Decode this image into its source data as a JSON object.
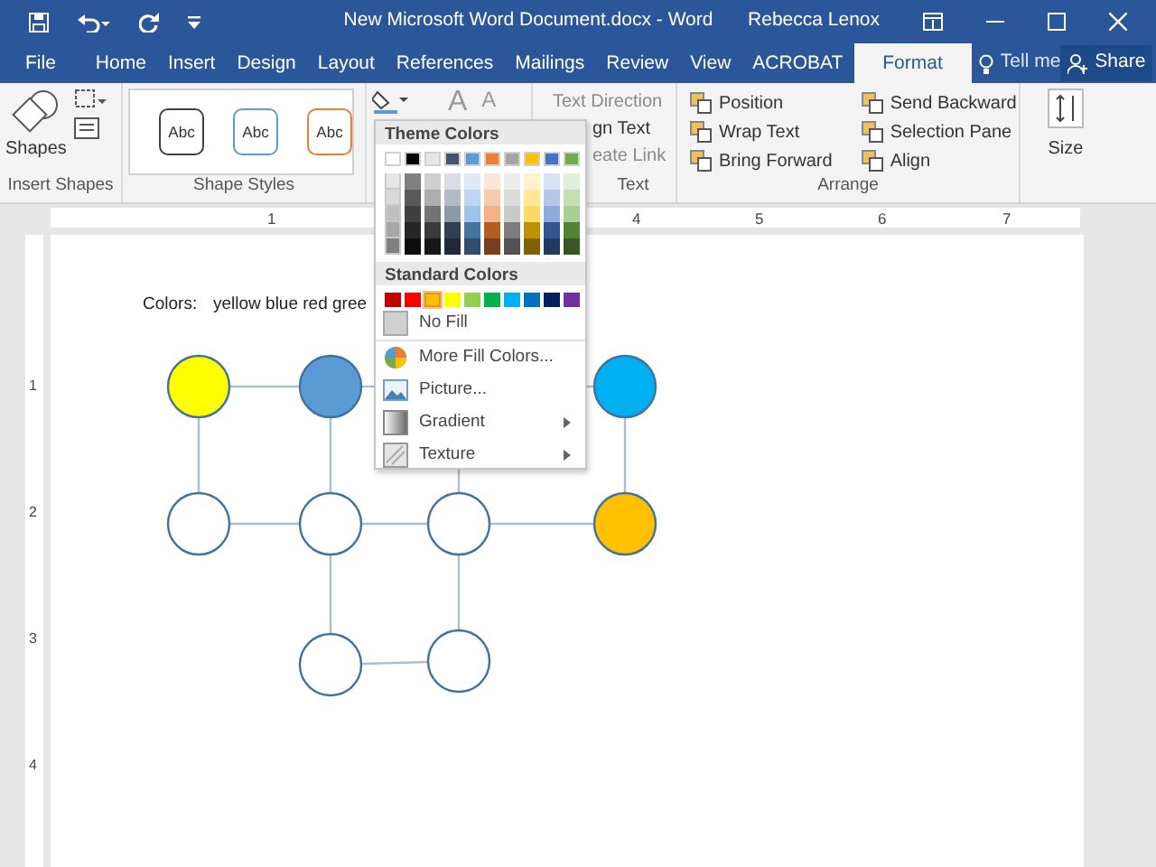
{
  "window": {
    "title": "New Microsoft Word Document.docx - Word",
    "user": "Rebecca Lenox"
  },
  "tabs": [
    {
      "label": "File",
      "selected": false
    },
    {
      "label": "Home",
      "selected": false
    },
    {
      "label": "Insert",
      "selected": false
    },
    {
      "label": "Design",
      "selected": false
    },
    {
      "label": "Layout",
      "selected": false
    },
    {
      "label": "References",
      "selected": false
    },
    {
      "label": "Mailings",
      "selected": false
    },
    {
      "label": "Review",
      "selected": false
    },
    {
      "label": "View",
      "selected": false
    },
    {
      "label": "ACROBAT",
      "selected": false
    },
    {
      "label": "Format",
      "selected": true
    }
  ],
  "tell_me": "Tell me",
  "share": "Share",
  "ribbon": {
    "insert_shapes": {
      "shapes_label": "Shapes",
      "group": "Insert Shapes"
    },
    "shape_styles": {
      "samples": [
        {
          "label": "Abc",
          "color": "#404040"
        },
        {
          "label": "Abc",
          "color": "#5b9bd5"
        },
        {
          "label": "Abc",
          "color": "#ed7d31"
        }
      ],
      "group": "Shape Styles"
    },
    "wordart": {
      "letters": [
        "A",
        "A"
      ]
    },
    "text": {
      "items": [
        {
          "label": "Text Direction",
          "disabled": true
        },
        {
          "label": "gn Text",
          "disabled": false
        },
        {
          "label": "eate Link",
          "disabled": true
        }
      ],
      "group": "Text"
    },
    "arrange": {
      "left": [
        "Position",
        "Wrap Text",
        "Bring Forward"
      ],
      "right": [
        "Send Backward",
        "Selection Pane",
        "Align"
      ],
      "group": "Arrange"
    },
    "size": {
      "label": "Size"
    }
  },
  "ruler": {
    "numbers": [
      "1",
      "4",
      "5",
      "6",
      "7"
    ],
    "vertical_numbers": [
      "1",
      "2",
      "3",
      "4"
    ]
  },
  "document": {
    "label": "Colors:",
    "text": "yellow blue red gree",
    "nodes": [
      {
        "color": "#ffff00"
      },
      {
        "color": "#5b9bd5"
      },
      {
        "color": "#00b0f0"
      },
      {
        "color": "#ffffff"
      },
      {
        "color": "#ffffff"
      },
      {
        "color": "#ffffff"
      },
      {
        "color": "#ffc000"
      },
      {
        "color": "#ffffff"
      },
      {
        "color": "#ffffff"
      }
    ]
  },
  "fill_menu": {
    "theme_header": "Theme Colors",
    "theme_colors": [
      {
        "color": "#ffffff"
      },
      {
        "color": "#000000"
      },
      {
        "color": "#e7e6e6"
      },
      {
        "color": "#44546a"
      },
      {
        "color": "#5b9bd5"
      },
      {
        "color": "#ed7d31"
      },
      {
        "color": "#a5a5a5"
      },
      {
        "color": "#ffc000"
      },
      {
        "color": "#4472c4"
      },
      {
        "color": "#70ad47"
      }
    ],
    "standard_header": "Standard Colors",
    "standard_colors": [
      {
        "color": "#c00000",
        "hovered": false
      },
      {
        "color": "#ff0000",
        "hovered": false
      },
      {
        "color": "#ffc000",
        "hovered": true
      },
      {
        "color": "#ffff00",
        "hovered": false
      },
      {
        "color": "#92d050",
        "hovered": false
      },
      {
        "color": "#00b050",
        "hovered": false
      },
      {
        "color": "#00b0f0",
        "hovered": false
      },
      {
        "color": "#0070c0",
        "hovered": false
      },
      {
        "color": "#002060",
        "hovered": false
      },
      {
        "color": "#7030a0",
        "hovered": false
      }
    ],
    "items": [
      {
        "kind": "nofill",
        "label": "No Fill",
        "submenu": false
      },
      {
        "kind": "more",
        "label": "More Fill Colors...",
        "submenu": false
      },
      {
        "kind": "picture",
        "label": "Picture...",
        "submenu": false
      },
      {
        "kind": "gradient",
        "label": "Gradient",
        "submenu": true
      },
      {
        "kind": "texture",
        "label": "Texture",
        "submenu": true
      }
    ]
  }
}
